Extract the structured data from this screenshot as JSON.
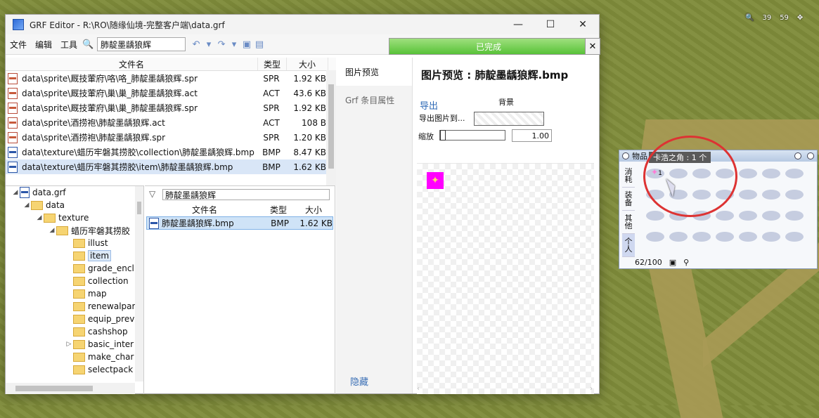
{
  "window": {
    "title": "GRF Editor - R:\\RO\\随缘仙境-完整客户端\\data.grf",
    "controls": {
      "minimize": "—",
      "maximize": "☐",
      "close": "✕"
    }
  },
  "toolbar": {
    "menu": [
      "文件",
      "编辑",
      "工具"
    ],
    "search_value": "肺靛墨龋狼辉",
    "progress_text": "已完成",
    "progress_value": 1.0
  },
  "top_list": {
    "headers": {
      "name": "文件名",
      "type": "类型",
      "size": "大小"
    },
    "rows": [
      {
        "name": "data\\sprite\\厩技葷府\\咯\\咯_肺靛墨龋狼辉.spr",
        "type": "SPR",
        "size": "1.92 KB"
      },
      {
        "name": "data\\sprite\\厩技葷府\\巢\\巢_肺靛墨龋狼辉.act",
        "type": "ACT",
        "size": "43.6 KB"
      },
      {
        "name": "data\\sprite\\厩技葷府\\巢\\巢_肺靛墨龋狼辉.spr",
        "type": "SPR",
        "size": "1.92 KB"
      },
      {
        "name": "data\\sprite\\酒捞袍\\肺靛墨龋狼辉.act",
        "type": "ACT",
        "size": "108 B"
      },
      {
        "name": "data\\sprite\\酒捞袍\\肺靛墨龋狼辉.spr",
        "type": "SPR",
        "size": "1.20 KB"
      },
      {
        "name": "data\\texture\\蜡历牢磐其捞胶\\collection\\肺靛墨龋狼辉.bmp",
        "type": "BMP",
        "size": "8.47 KB"
      },
      {
        "name": "data\\texture\\蜡历牢磐其捞胶\\item\\肺靛墨龋狼辉.bmp",
        "type": "BMP",
        "size": "1.62 KB"
      }
    ]
  },
  "tree": {
    "nodes": [
      {
        "label": "data.grf"
      },
      {
        "label": "data"
      },
      {
        "label": "texture"
      },
      {
        "label": "蜡历牢磐其捞胶"
      },
      {
        "label": "illust"
      },
      {
        "label": "item"
      },
      {
        "label": "grade_encl"
      },
      {
        "label": "collection"
      },
      {
        "label": "map"
      },
      {
        "label": "renewalpar"
      },
      {
        "label": "equip_prev"
      },
      {
        "label": "cashshop"
      },
      {
        "label": "basic_inter"
      },
      {
        "label": "make_char"
      },
      {
        "label": "selectpack"
      }
    ]
  },
  "filter": {
    "value": "肺靛墨龋狼辉",
    "headers": {
      "name": "文件名",
      "type": "类型",
      "size": "大小"
    },
    "row": {
      "name": "肺靛墨龋狼辉.bmp",
      "type": "BMP",
      "size": "1.62 KB"
    }
  },
  "tabs": {
    "preview": "图片预览",
    "props": "Grf 条目属性",
    "hide": "隐藏"
  },
  "preview": {
    "title": "图片预览 : 肺靛墨龋狼辉.bmp",
    "export": "导出",
    "background": "背景",
    "export_to": "导出图片到...",
    "zoom_label": "缩放",
    "zoom_value": "1.00"
  },
  "hud": {
    "a": "39",
    "b": "59"
  },
  "inventory": {
    "title": "物品",
    "tooltip": "卡浩之角 : 1 个",
    "tabs": [
      "消耗",
      "装备",
      "其他",
      "个人"
    ],
    "slot_count_label": "62/100",
    "item_qty": "1"
  }
}
